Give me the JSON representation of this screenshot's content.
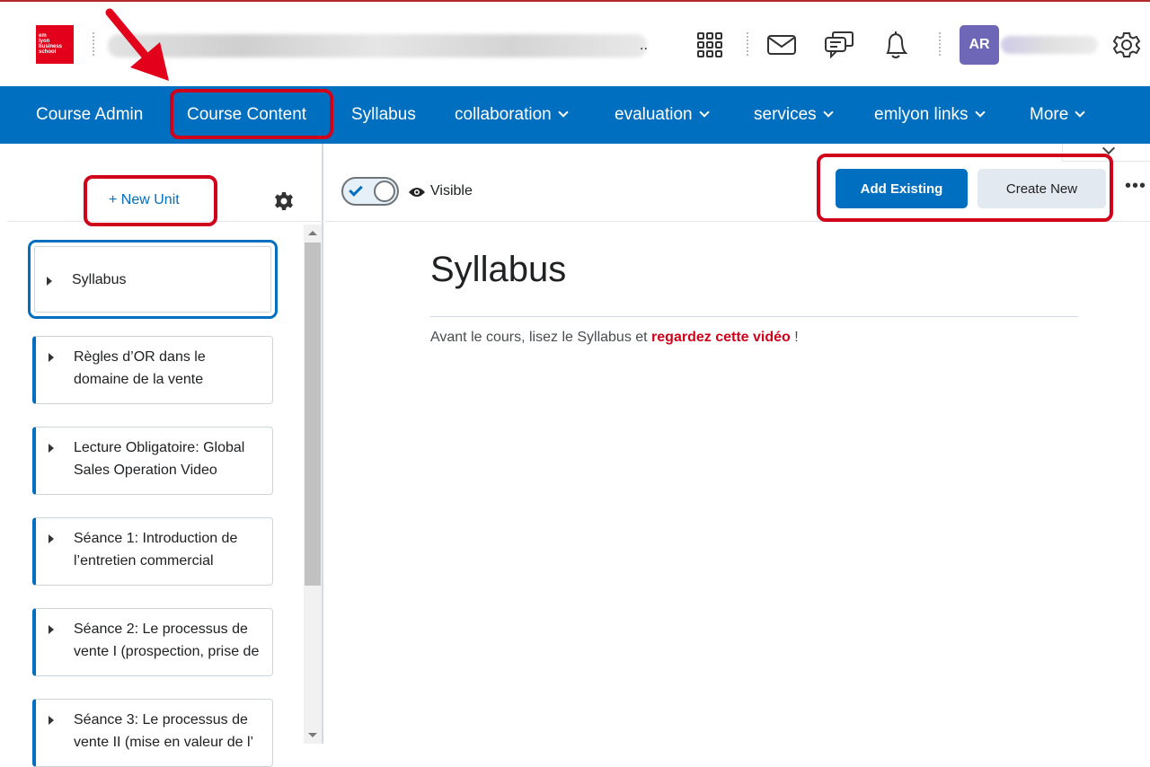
{
  "header": {
    "logo_text": [
      "em",
      "lyon",
      "business",
      "school"
    ],
    "avatar_initials": "AR",
    "blurred_title_suffix": ".."
  },
  "nav": {
    "items": [
      {
        "label": "Course Admin",
        "dropdown": false
      },
      {
        "label": "Course Content",
        "dropdown": false
      },
      {
        "label": "Syllabus",
        "dropdown": false
      },
      {
        "label": "collaboration",
        "dropdown": true
      },
      {
        "label": "evaluation",
        "dropdown": true
      },
      {
        "label": "services",
        "dropdown": true
      },
      {
        "label": "emlyon links",
        "dropdown": true
      },
      {
        "label": "More",
        "dropdown": true
      }
    ]
  },
  "sidebar": {
    "new_unit_label": "+ New Unit",
    "units": [
      {
        "title": "Syllabus",
        "selected": true
      },
      {
        "title": "Règles d’OR dans le domaine de la vente"
      },
      {
        "title": "Lecture Obligatoire: Global Sales Operation Video"
      },
      {
        "title": "Séance 1: Introduction de l’entretien commercial"
      },
      {
        "title": "Séance 2: Le processus de vente I (prospection, prise de"
      },
      {
        "title": "Séance 3: Le processus de vente II (mise en valeur de l’"
      }
    ]
  },
  "main": {
    "visibility_label": "Visible",
    "visible": true,
    "add_existing_label": "Add Existing",
    "create_new_label": "Create New",
    "title": "Syllabus",
    "body_prefix": "Avant le cours, lisez le Syllabus et ",
    "body_link": "regardez cette vidéo",
    "body_suffix": " !"
  },
  "colors": {
    "brand": "#006fbf",
    "annotation": "#d0021b",
    "logo": "#e2001a",
    "avatar": "#6e67b8"
  }
}
